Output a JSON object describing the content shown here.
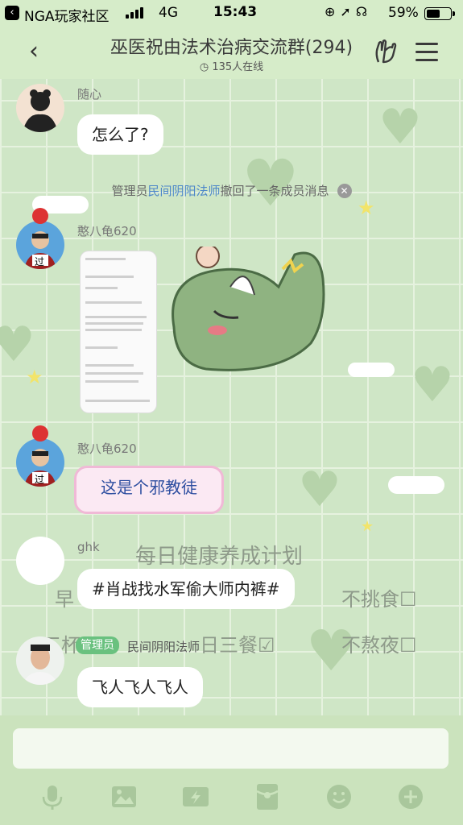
{
  "status_bar": {
    "carrier": "NGA玩家社区",
    "network": "4G",
    "time": "15:43",
    "battery_percent": "59%",
    "battery_level": 0.59
  },
  "header": {
    "title": "巫医祝由法术治病交流群(294)",
    "online": "135人在线"
  },
  "messages": [
    {
      "nick": "随心",
      "text": "怎么了?"
    },
    {
      "nick": "憨八龟620",
      "image": "聊天截图"
    },
    {
      "nick": "憨八龟620",
      "text": "这是个邪教徒"
    },
    {
      "nick": "ghk",
      "text": "#肖战找水军偷大师内裤#"
    },
    {
      "role": "管理员",
      "nick": "民间阴阳法师",
      "text": "飞人飞人飞人"
    }
  ],
  "system_message": {
    "prefix": "管理员",
    "who": "民间阴阳法师",
    "suffix": "撤回了一条成员消息"
  },
  "background_text": {
    "plan_title": "每日健康养成计划",
    "left1": "早",
    "item_no_picky": "不挑食☐",
    "left2": "三杯",
    "item_three_meals": "日三餐☑",
    "item_no_late": "不熬夜☐"
  },
  "avatar_labels": {
    "badge": "过"
  },
  "toolbar": [
    "microphone-icon",
    "image-icon",
    "flash-icon",
    "red-packet-icon",
    "emoji-icon",
    "plus-icon"
  ],
  "colors": {
    "bar_bg": "#d6ecc9",
    "chat_bg": "#cfe6c6",
    "link": "#4d87c9",
    "admin_badge": "#6ac17f"
  }
}
